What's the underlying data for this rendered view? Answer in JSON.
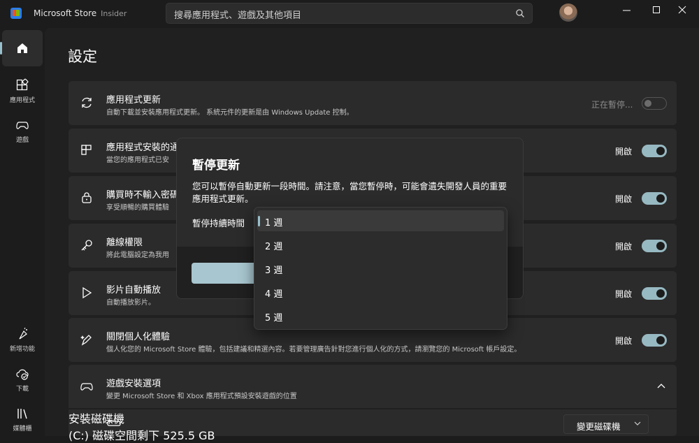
{
  "titlebar": {
    "app_name": "Microsoft Store",
    "channel": "Insider",
    "search_placeholder": "搜尋應用程式、遊戲及其他項目"
  },
  "sidebar": {
    "items": [
      {
        "label": "",
        "icon": "home-icon",
        "active": true
      },
      {
        "label": "應用程式",
        "icon": "apps-icon"
      },
      {
        "label": "遊戲",
        "icon": "gamepad-icon"
      },
      {
        "label": "新增功能",
        "icon": "whats-new-icon"
      },
      {
        "label": "下載",
        "icon": "download-icon"
      },
      {
        "label": "媒體櫃",
        "icon": "library-icon"
      }
    ]
  },
  "page": {
    "title": "設定",
    "settings": [
      {
        "icon": "refresh-icon",
        "title": "應用程式更新",
        "desc": "自動下載並安裝應用程式更新。 系統元件的更新是由 Windows Update 控制。",
        "state": "正在暫停...",
        "on": false
      },
      {
        "icon": "install-icon",
        "title": "應用程式安裝的通",
        "desc": "當您的應用程式已安",
        "state": "開啟",
        "on": true
      },
      {
        "icon": "lock-icon",
        "title": "購買時不輸入密碼",
        "desc": "享受順暢的購買體驗",
        "state": "開啟",
        "on": true
      },
      {
        "icon": "key-icon",
        "title": "離線權限",
        "desc": "將此電腦設定為我用",
        "state": "開啟",
        "on": true
      },
      {
        "icon": "play-icon",
        "title": "影片自動播放",
        "desc": "自動播放影片。",
        "state": "開啟",
        "on": true
      },
      {
        "icon": "sparkle-pen-icon",
        "title": "關閉個人化體驗",
        "desc": "個人化您的 Microsoft Store 體驗，包括建議和精選內容。若要管理廣告針對您進行個人化的方式，請瀏覽您的 Microsoft 帳戶設定。",
        "state": "開啟",
        "on": true
      }
    ],
    "game_install": {
      "title": "遊戲安裝選項",
      "desc": "變更 Microsoft Store 和 Xbox 應用程式預設安裝遊戲的位置",
      "drive_title": "安裝磁碟機",
      "drive_desc": "(C:) 磁碟空間剩下 525.5 GB",
      "change_button": "變更磁碟機"
    }
  },
  "dialog": {
    "title": "暫停更新",
    "body": "您可以暫停自動更新一段時間。請注意，當您暫停時，可能會遺失開發人員的重要應用程式更新。",
    "duration_label": "暫停持續時間",
    "options": [
      "1 週",
      "2 週",
      "3 週",
      "4 週",
      "5 週"
    ],
    "selected_index": 0
  },
  "colors": {
    "accent": "#98c0cc",
    "toggle_on": "#97b9c2",
    "background": "#202020",
    "card": "#2b2b2b"
  }
}
